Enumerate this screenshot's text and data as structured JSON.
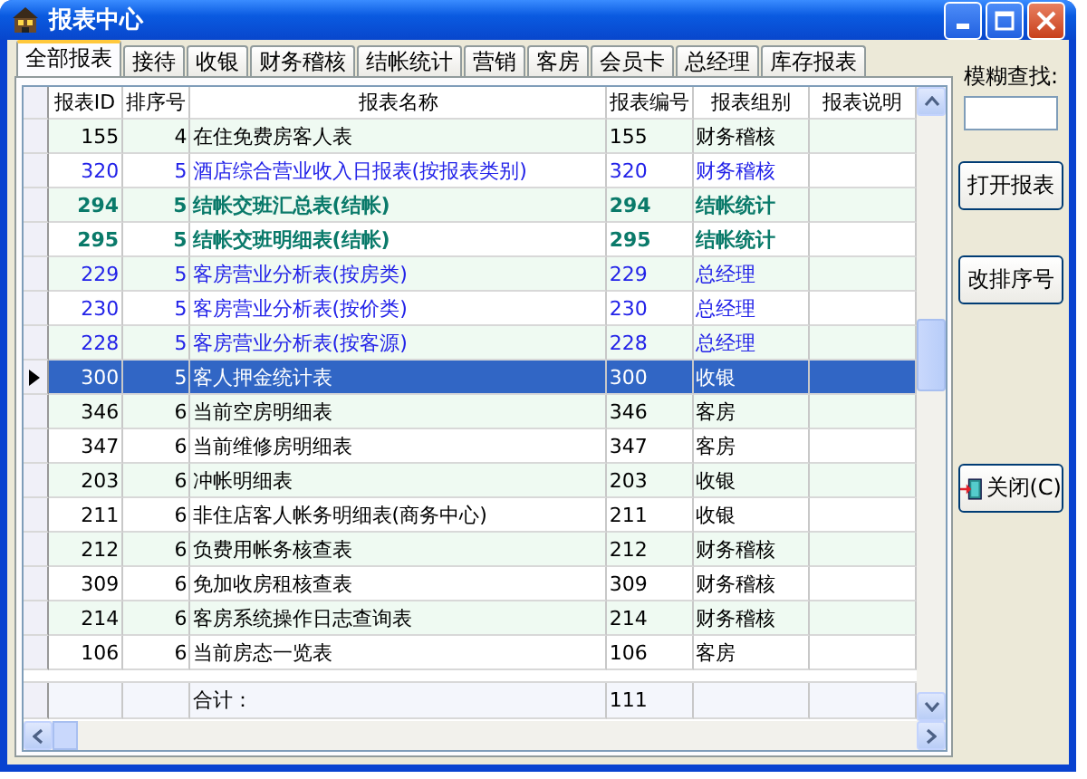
{
  "window": {
    "title": "报表中心"
  },
  "tabs": [
    {
      "label": "全部报表",
      "selected": true
    },
    {
      "label": "接待",
      "selected": false
    },
    {
      "label": "收银",
      "selected": false
    },
    {
      "label": "财务稽核",
      "selected": false
    },
    {
      "label": "结帐统计",
      "selected": false
    },
    {
      "label": "营销",
      "selected": false
    },
    {
      "label": "客房",
      "selected": false
    },
    {
      "label": "会员卡",
      "selected": false
    },
    {
      "label": "总经理",
      "selected": false
    },
    {
      "label": "库存报表",
      "selected": false
    }
  ],
  "table": {
    "columns": [
      "报表ID",
      "排序号",
      "报表名称",
      "报表编号",
      "报表组别",
      "报表说明"
    ],
    "rows": [
      {
        "id": "155",
        "order": "4",
        "name": "在住免费房客人表",
        "code": "155",
        "group": "财务稽核",
        "kind": "normal",
        "selected": false
      },
      {
        "id": "320",
        "order": "5",
        "name": "酒店综合营业收入日报表(按报表类别)",
        "code": "320",
        "group": "财务稽核",
        "kind": "blue",
        "selected": false
      },
      {
        "id": "294",
        "order": "5",
        "name": "结帐交班汇总表(结帐)",
        "code": "294",
        "group": "结帐统计",
        "kind": "bold",
        "selected": false
      },
      {
        "id": "295",
        "order": "5",
        "name": "结帐交班明细表(结帐)",
        "code": "295",
        "group": "结帐统计",
        "kind": "bold",
        "selected": false
      },
      {
        "id": "229",
        "order": "5",
        "name": "客房营业分析表(按房类)",
        "code": "229",
        "group": "总经理",
        "kind": "blue",
        "selected": false
      },
      {
        "id": "230",
        "order": "5",
        "name": "客房营业分析表(按价类)",
        "code": "230",
        "group": "总经理",
        "kind": "blue",
        "selected": false
      },
      {
        "id": "228",
        "order": "5",
        "name": "客房营业分析表(按客源)",
        "code": "228",
        "group": "总经理",
        "kind": "blue",
        "selected": false
      },
      {
        "id": "300",
        "order": "5",
        "name": "客人押金统计表",
        "code": "300",
        "group": "收银",
        "kind": "normal",
        "selected": true
      },
      {
        "id": "346",
        "order": "6",
        "name": "当前空房明细表",
        "code": "346",
        "group": "客房",
        "kind": "normal",
        "selected": false
      },
      {
        "id": "347",
        "order": "6",
        "name": "当前维修房明细表",
        "code": "347",
        "group": "客房",
        "kind": "normal",
        "selected": false
      },
      {
        "id": "203",
        "order": "6",
        "name": "冲帐明细表",
        "code": "203",
        "group": "收银",
        "kind": "normal",
        "selected": false
      },
      {
        "id": "211",
        "order": "6",
        "name": "非住店客人帐务明细表(商务中心)",
        "code": "211",
        "group": "收银",
        "kind": "normal",
        "selected": false
      },
      {
        "id": "212",
        "order": "6",
        "name": "负费用帐务核查表",
        "code": "212",
        "group": "财务稽核",
        "kind": "normal",
        "selected": false
      },
      {
        "id": "309",
        "order": "6",
        "name": "免加收房租核查表",
        "code": "309",
        "group": "财务稽核",
        "kind": "normal",
        "selected": false
      },
      {
        "id": "214",
        "order": "6",
        "name": "客房系统操作日志查询表",
        "code": "214",
        "group": "财务稽核",
        "kind": "normal",
        "selected": false
      },
      {
        "id": "106",
        "order": "6",
        "name": "当前房态一览表",
        "code": "106",
        "group": "客房",
        "kind": "normal",
        "selected": false
      }
    ],
    "total": {
      "label": "合计：",
      "value": "111"
    }
  },
  "search": {
    "label": "模糊查找:"
  },
  "buttons": [
    {
      "label": "打开报表",
      "kind": "plain"
    },
    {
      "label": "改排序号",
      "kind": "plain"
    },
    {
      "label": "关闭(C)",
      "kind": "exit"
    }
  ]
}
